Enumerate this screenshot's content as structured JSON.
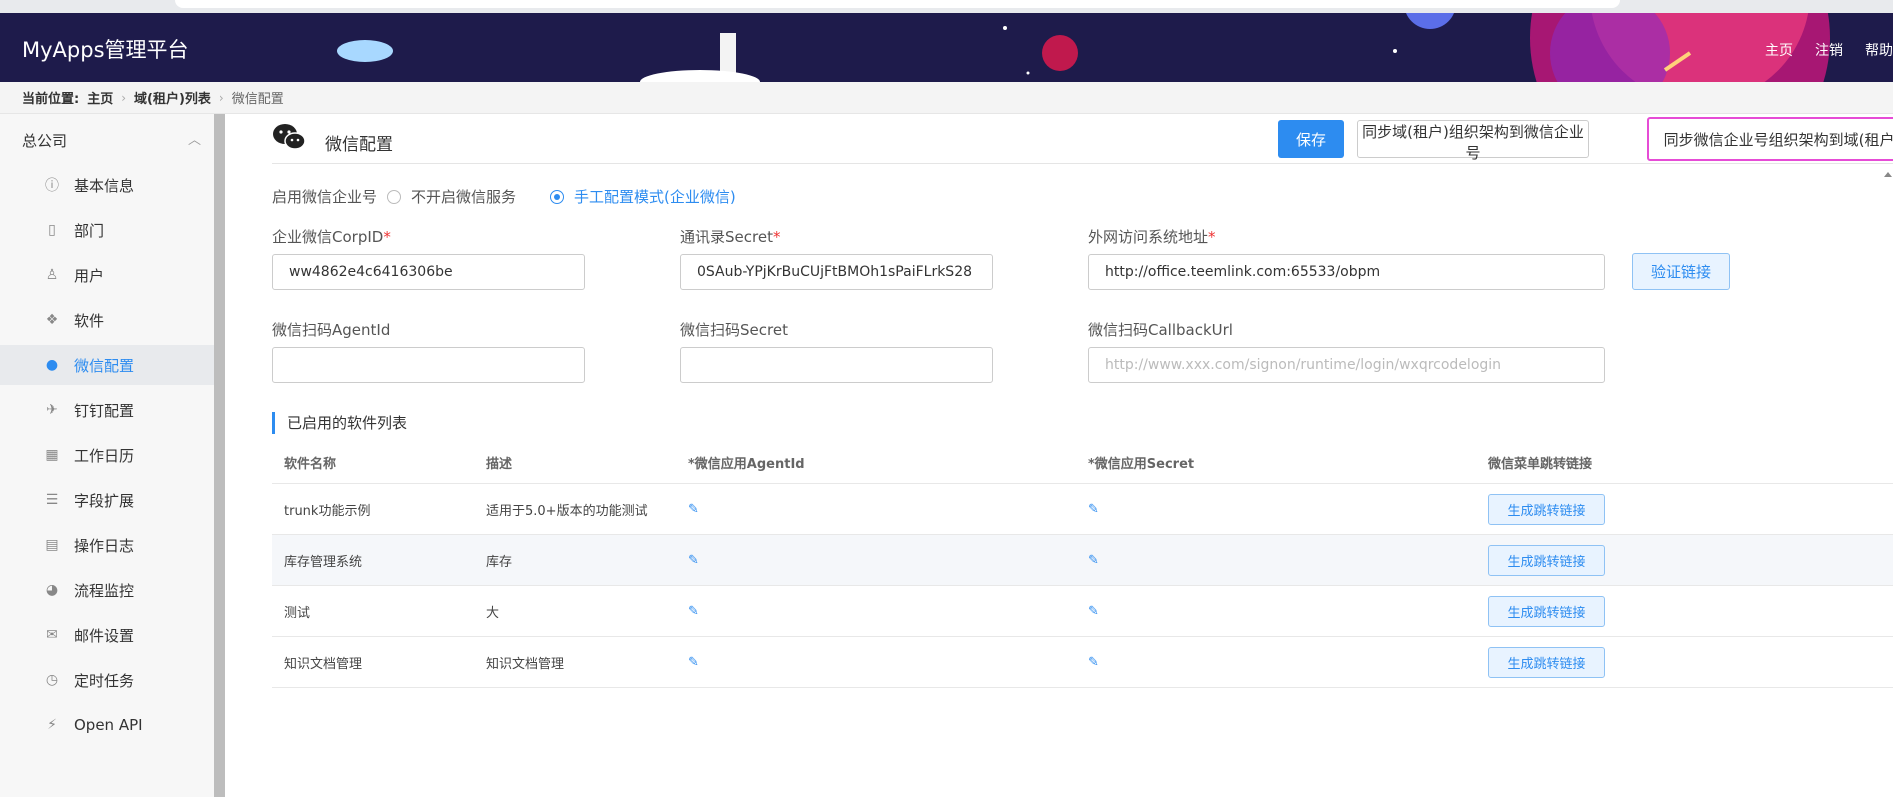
{
  "header": {
    "logo": "MyApps管理平台",
    "links": [
      "主页",
      "注销",
      "帮助"
    ]
  },
  "breadcrumb": {
    "prefix": "当前位置:",
    "items": [
      "主页",
      "域(租户)列表",
      "微信配置"
    ]
  },
  "sidebar": {
    "org": "总公司",
    "items": [
      {
        "label": "基本信息",
        "icon": "info-icon"
      },
      {
        "label": "部门",
        "icon": "building-icon"
      },
      {
        "label": "用户",
        "icon": "user-icon"
      },
      {
        "label": "软件",
        "icon": "cubes-icon"
      },
      {
        "label": "微信配置",
        "icon": "wechat-icon",
        "active": true
      },
      {
        "label": "钉钉配置",
        "icon": "plane-icon"
      },
      {
        "label": "工作日历",
        "icon": "calendar-icon"
      },
      {
        "label": "字段扩展",
        "icon": "sliders-icon"
      },
      {
        "label": "操作日志",
        "icon": "log-icon"
      },
      {
        "label": "流程监控",
        "icon": "dashboard-icon"
      },
      {
        "label": "邮件设置",
        "icon": "mail-icon"
      },
      {
        "label": "定时任务",
        "icon": "clock-icon"
      },
      {
        "label": "Open API",
        "icon": "plug-icon"
      }
    ]
  },
  "page": {
    "title": "微信配置",
    "save": "保存",
    "sync_to_wechat": "同步域(租户)组织架构到微信企业号",
    "sync_from_wechat": "同步微信企业号组织架构到域(租户)"
  },
  "toggle": {
    "label": "启用微信企业号",
    "off": "不开启微信服务",
    "on": "手工配置模式(企业微信)",
    "selected": "on"
  },
  "form": {
    "corpid_label": "企业微信CorpID",
    "corpid_value": "ww4862e4c6416306be",
    "secret_label": "通讯录Secret",
    "secret_value": "0SAub-YPjKrBuCUjFtBMOh1sPaiFLrkS28",
    "url_label": "外网访问系统地址",
    "url_value": "http://office.teemlink.com:65533/obpm",
    "verify": "验证链接",
    "agentid_label": "微信扫码AgentId",
    "agentid_value": "",
    "scan_secret_label": "微信扫码Secret",
    "scan_secret_value": "",
    "callback_label": "微信扫码CallbackUrl",
    "callback_placeholder": "http://www.xxx.com/signon/runtime/login/wxqrcodelogin",
    "required_mark": "*"
  },
  "section_title": "已启用的软件列表",
  "table": {
    "columns": [
      "软件名称",
      "描述",
      "*微信应用AgentId",
      "*微信应用Secret",
      "微信菜单跳转链接"
    ],
    "rows": [
      {
        "name": "trunk功能示例",
        "desc": "适用于5.0+版本的功能测试",
        "action": "生成跳转链接"
      },
      {
        "name": "库存管理系统",
        "desc": "库存",
        "action": "生成跳转链接"
      },
      {
        "name": "测试",
        "desc": "大",
        "action": "生成跳转链接"
      },
      {
        "name": "知识文档管理",
        "desc": "知识文档管理",
        "action": "生成跳转链接"
      }
    ]
  },
  "colors": {
    "header_bg": "#1e1b4b",
    "accent": "#2d8cf0",
    "highlight": "#e64cd6"
  }
}
